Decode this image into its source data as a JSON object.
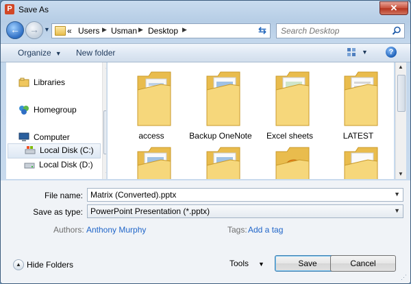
{
  "window": {
    "title": "Save As",
    "app_icon_letter": "P"
  },
  "navigation": {
    "breadcrumb_overflow": "«",
    "breadcrumb": [
      "Users",
      "Usman",
      "Desktop"
    ],
    "search_placeholder": "Search Desktop"
  },
  "toolbar": {
    "organize": "Organize",
    "new_folder": "New folder",
    "help": "?"
  },
  "nav_pane": {
    "items": [
      {
        "label": "Libraries",
        "icon": "libraries-icon"
      },
      {
        "label": "Homegroup",
        "icon": "homegroup-icon"
      },
      {
        "label": "Computer",
        "icon": "computer-icon"
      },
      {
        "label": "Local Disk (C:)",
        "icon": "local-disk-c-icon",
        "selected": true
      },
      {
        "label": "Local Disk (D:)",
        "icon": "local-disk-d-icon"
      }
    ]
  },
  "files": [
    {
      "name": "access"
    },
    {
      "name": "Backup OneNote"
    },
    {
      "name": "Excel sheets"
    },
    {
      "name": "LATEST"
    },
    {
      "name": ""
    },
    {
      "name": ""
    },
    {
      "name": ""
    },
    {
      "name": ""
    }
  ],
  "form": {
    "file_name_label": "File name:",
    "file_name_value": "Matrix (Converted).pptx",
    "save_as_type_label": "Save as type:",
    "save_as_type_value": "PowerPoint Presentation (*.pptx)",
    "authors_label": "Authors:",
    "authors_value": "Anthony Murphy",
    "tags_label": "Tags:",
    "tags_value": "Add a tag"
  },
  "footer": {
    "hide_folders": "Hide Folders",
    "tools": "Tools",
    "save": "Save",
    "cancel": "Cancel"
  },
  "colors": {
    "accent": "#1e64c8",
    "folder": "#f2cf6a",
    "app_icon": "#d24726"
  }
}
